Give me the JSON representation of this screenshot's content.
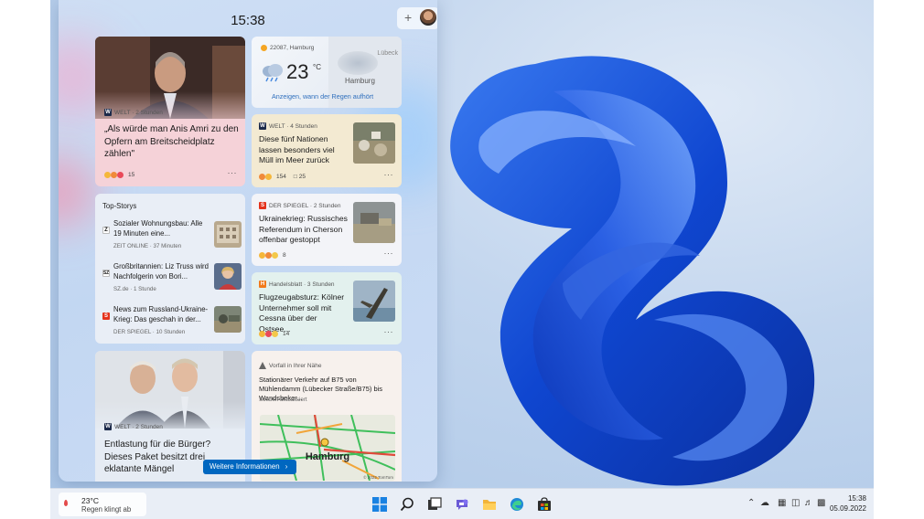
{
  "clock": "15:38",
  "cards": {
    "hero": {
      "source": "WELT · 2 Stunden",
      "headline": "„Als würde man Anis Amri zu den Opfern am Breitscheidplatz zählen\"",
      "reactions": "15"
    },
    "weather": {
      "location": "22087, Hamburg",
      "temp": "23",
      "unit": "°C",
      "map_place1": "Lübeck",
      "map_place2": "Hamburg",
      "link": "Anzeigen, wann der Regen aufhört"
    },
    "plastic": {
      "source": "WELT · 4 Stunden",
      "headline": "Diese fünf Nationen lassen besonders viel Müll im Meer zurück",
      "reactions": "154",
      "comments": "25"
    },
    "topstories": {
      "title": "Top-Storys",
      "items": [
        {
          "headline": "Sozialer Wohnungsbau: Alle 19 Minuten eine...",
          "meta": "ZEIT ONLINE · 37 Minuten",
          "logo": "Z"
        },
        {
          "headline": "Großbritannien: Liz Truss wird Nachfolgerin von Bori...",
          "meta": "SZ.de · 1 Stunde",
          "logo": "SZ"
        },
        {
          "headline": "News zum Russland-Ukraine-Krieg: Das geschah in der...",
          "meta": "DER SPIEGEL · 10 Stunden",
          "logo": "S"
        }
      ]
    },
    "ukraine": {
      "source": "DER SPIEGEL · 2 Stunden",
      "headline": "Ukrainekrieg: Russisches Referendum in Cherson offenbar gestoppt",
      "reactions": "8"
    },
    "flight": {
      "source": "Handelsblatt · 3 Stunden",
      "headline": "Flugzeugabsturz: Kölner Unternehmer soll mit Cessna über der Ostsee...",
      "reactions": "14"
    },
    "bottom": {
      "source": "WELT · 2 Stunden",
      "headline": "Entlastung für die Bürger? Dieses Paket besitzt drei eklatante Mängel"
    },
    "traffic": {
      "source": "Vorfall in Ihrer Nähe",
      "headline": "Stationärer Verkehr auf B75 von Mühlendamm (Lübecker Straße/B75) bis Wandsbeker...",
      "status": "Soeben aktualisiert",
      "map_label": "Hamburg",
      "map_credit": "© 2022 TomTom"
    }
  },
  "more_info_button": "Weitere Informationen",
  "more_dots": "···",
  "taskbar": {
    "weather_temp": "23°C",
    "weather_text": "Regen klingt ab",
    "time": "15:38",
    "date": "05.09.2022"
  },
  "colors": {
    "accent": "#0067c0",
    "bloom": "#1a4fd6"
  }
}
